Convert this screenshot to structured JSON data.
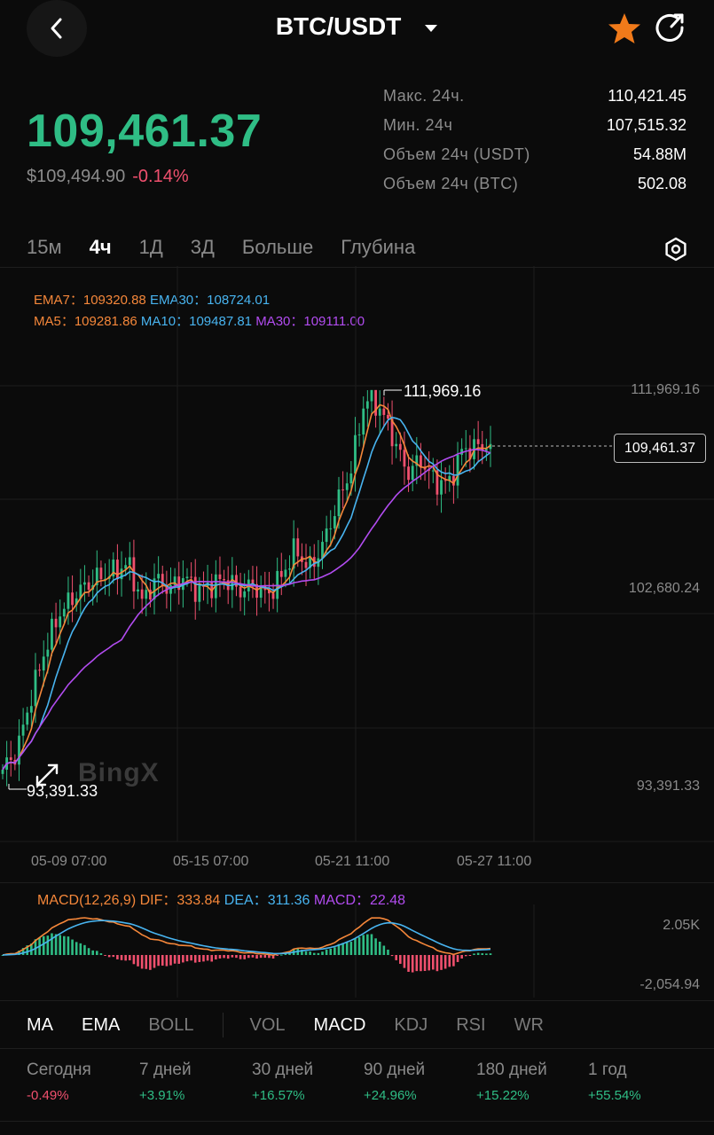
{
  "header": {
    "title": "BTC/USDT"
  },
  "price": {
    "last": "109,461.37",
    "usd": "$109,494.90",
    "change": "-0.14%"
  },
  "stats": [
    {
      "label": "Макс. 24ч.",
      "value": "110,421.45"
    },
    {
      "label": "Мин. 24ч",
      "value": "107,515.32"
    },
    {
      "label": "Объем 24ч (USDT)",
      "value": "54.88M"
    },
    {
      "label": "Объем 24ч (BTC)",
      "value": "502.08"
    }
  ],
  "timeframes": [
    "15м",
    "4ч",
    "1Д",
    "3Д",
    "Больше",
    "Глубина"
  ],
  "active_timeframe": "4ч",
  "indicators": {
    "ema7_label": "EMA7：",
    "ema7": "109320.88",
    "ema30_label": "EMA30：",
    "ema30": "108724.01",
    "ma5_label": "MA5：",
    "ma5": "109281.86",
    "ma10_label": "MA10：",
    "ma10": "109487.81",
    "ma30_label": "MA30：",
    "ma30": "109111.00"
  },
  "y_axis": [
    "111,969.16",
    "102,680.24",
    "93,391.33"
  ],
  "x_axis": [
    "05-09 07:00",
    "05-15 07:00",
    "05-21 11:00",
    "05-27 11:00"
  ],
  "chart": {
    "high_marker": "111,969.16",
    "low_marker": "93,391.33",
    "current_price": "109,461.37",
    "watermark": "BingX",
    "colors": {
      "up": "#2fbd85",
      "down": "#f0506e",
      "ma5": "#f5873a",
      "ma10": "#48b4f0",
      "ma30": "#b24cf0"
    }
  },
  "chart_data": {
    "type": "candlestick",
    "x_range": [
      "05-07 19:00",
      "05-27 19:00"
    ],
    "ylim": [
      93391.33,
      111969.16
    ],
    "y_ticks": [
      111969.16,
      102680.24,
      93391.33
    ],
    "high": 111969.16,
    "low": 93391.33,
    "current": 109461.37,
    "close_series": [
      94300,
      95100,
      97600,
      99800,
      101500,
      102300,
      102900,
      103300,
      103500,
      103900,
      102100,
      103200,
      102700,
      103300,
      102600,
      102900,
      103200,
      102600,
      102900,
      102400,
      103300,
      104600,
      103600,
      104800,
      106700,
      108300,
      111600,
      111200,
      109800,
      108100,
      108700,
      107700,
      107600,
      109200,
      109300,
      109500
    ]
  },
  "macd": {
    "label": "MACD(12,26,9)",
    "dif_label": "DIF：",
    "dif": "333.84",
    "dea_label": "DEA：",
    "dea": "311.36",
    "macd_label": "MACD：",
    "macd": "22.48",
    "y_top": "2.05K",
    "y_bottom": "-2,054.94"
  },
  "indicator_tabs": [
    "MA",
    "EMA",
    "BOLL",
    "VOL",
    "MACD",
    "KDJ",
    "RSI",
    "WR"
  ],
  "performance": [
    {
      "label": "Сегодня",
      "value": "-0.49%"
    },
    {
      "label": "7 дней",
      "value": "+3.91%"
    },
    {
      "label": "30 дней",
      "value": "+16.57%"
    },
    {
      "label": "90 дней",
      "value": "+24.96%"
    },
    {
      "label": "180 дней",
      "value": "+15.22%"
    },
    {
      "label": "1 год",
      "value": "+55.54%"
    }
  ]
}
